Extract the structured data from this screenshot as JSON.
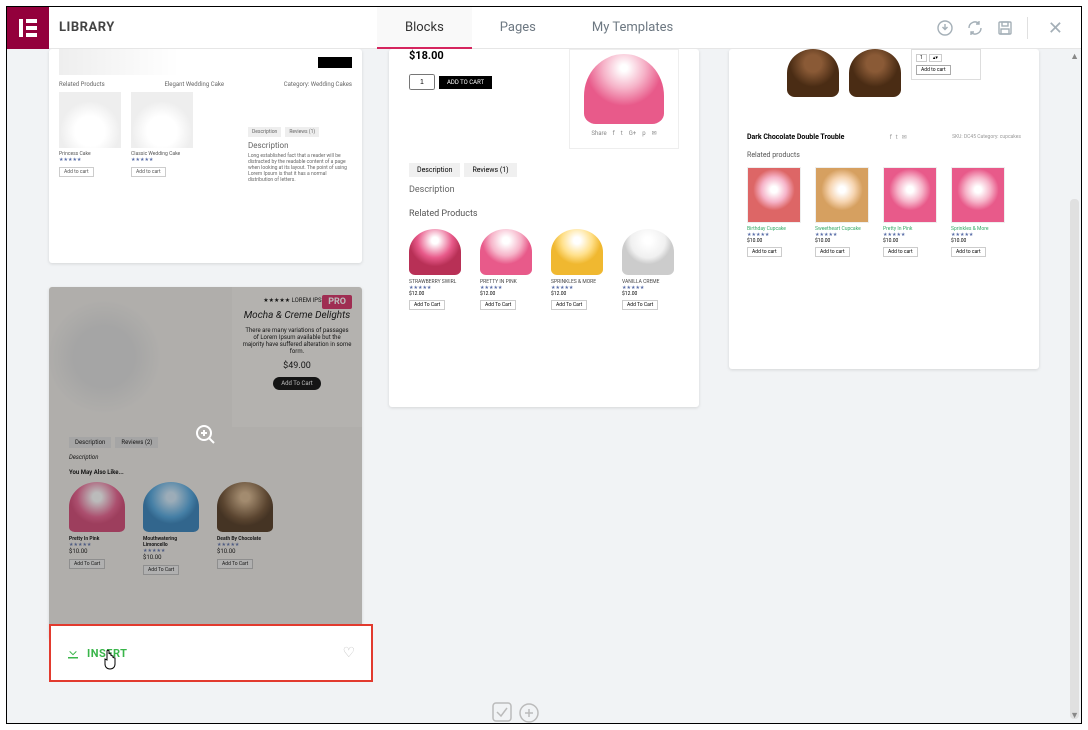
{
  "header": {
    "title": "LIBRARY",
    "tabs": {
      "blocks": "Blocks",
      "pages": "Pages",
      "mytemplates": "My Templates"
    }
  },
  "badges": {
    "pro": "PRO"
  },
  "card1": {
    "related": "Related Products",
    "brand": "Elegant Wedding Cake",
    "cat": "Category: Wedding Cakes",
    "cake1": "Princess Cake",
    "cake2": "Classic Wedding Cake",
    "addcart": "Add to cart",
    "tab_desc": "Description",
    "tab_rev": "Reviews (1)",
    "desc_title": "Description",
    "desc_body": "Long established fact that a reader will be distracted by the readable content of a page when looking at its layout. The point of using Lorem Ipsum is that it has a normal distribution of letters."
  },
  "card2": {
    "brand": "★★★★★  LOREM IPSUM",
    "title": "Mocha & Creme Delights",
    "blurb": "There are many variations of passages of Lorem Ipsum available but the majority have suffered alteration in some form.",
    "price": "$49.00",
    "addcart": "Add To Cart",
    "tab_desc": "Description",
    "tab_rev": "Reviews (2)",
    "desc": "Description",
    "like": "You May Also Like...",
    "c1": "Pretty In Pink",
    "c2": "Mouthwatering Limoncello",
    "c3": "Death By Chocolate",
    "stars": "★★★★★",
    "p": "$10.00",
    "atc": "Add To Cart",
    "insert": "INSERT"
  },
  "card3": {
    "price": "$18.00",
    "qty": "1",
    "addcart": "ADD TO CART",
    "share": "Share",
    "tab_desc": "Description",
    "tab_rev": "Reviews (1)",
    "desc": "Description",
    "related": "Related Products",
    "p1": "STRAWBERRY SWIRL",
    "p2": "PRETTY IN PINK",
    "p3": "SPRINKLES & MORE",
    "p4": "VANILLA CREME",
    "stars": "★★★★★",
    "pp": "$12.00",
    "atc": "Add To Cart"
  },
  "card4": {
    "qty1": "1",
    "addcart": "Add to cart",
    "title": "Dark Chocolate Double Trouble",
    "sku": "SKU: DC45",
    "cat": "Category: cupcakes",
    "related": "Related products",
    "p1": "Birthday Cupcake",
    "p2": "Sweetheart Cupcake",
    "p3": "Pretty In Pink",
    "p4": "Sprinkles & More",
    "stars": "★★★★★",
    "pp": "$10.00",
    "atc": "Add to cart"
  }
}
